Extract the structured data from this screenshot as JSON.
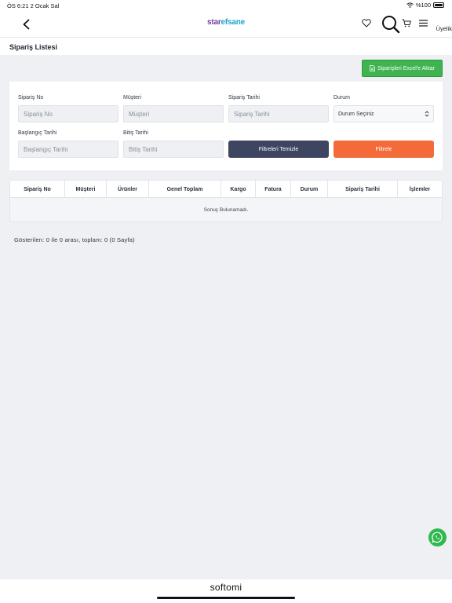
{
  "status_bar": {
    "time_date": "ÖS 6:21   2 Ocak Sal",
    "battery": "%100"
  },
  "header": {
    "logo_part1": "star",
    "logo_part2": "efsane",
    "menu_label": "Üyelik"
  },
  "page": {
    "title": "Sipariş Listesi"
  },
  "toolbar": {
    "excel_label": "Siparişleri Excel'e Aktar"
  },
  "filters": {
    "order_no": {
      "label": "Sipariş No",
      "placeholder": "Sipariş No"
    },
    "customer": {
      "label": "Müşteri",
      "placeholder": "Müşteri"
    },
    "order_date": {
      "label": "Sipariş Tarihi",
      "placeholder": "Sipariş Tarihi"
    },
    "status": {
      "label": "Durum",
      "value": "Durum Seçiniz"
    },
    "start_date": {
      "label": "Başlangıç Tarihi",
      "placeholder": "Başlangıç Tarihi"
    },
    "end_date": {
      "label": "Bitiş Tarihi",
      "placeholder": "Bitiş Tarihi"
    },
    "clear_label": "Filtreleri Temizle",
    "filter_label": "Filtrele"
  },
  "table": {
    "columns": [
      "Sipariş No",
      "Müşteri",
      "Ürünler",
      "Genel Toplam",
      "Kargo",
      "Fatura",
      "Durum",
      "Sipariş Tarihi",
      "İşlemler"
    ],
    "empty_text": "Sonuç Bulunamadı."
  },
  "pagination": {
    "info": "Gösterilen: 0 ile 0 arası, toplam: 0 (0 Sayfa)"
  },
  "footer": {
    "brand": "softomi"
  },
  "colors": {
    "excel": "#3fb34f",
    "clear": "#3d4560",
    "filter": "#f26b38",
    "whatsapp": "#2fb84d"
  }
}
